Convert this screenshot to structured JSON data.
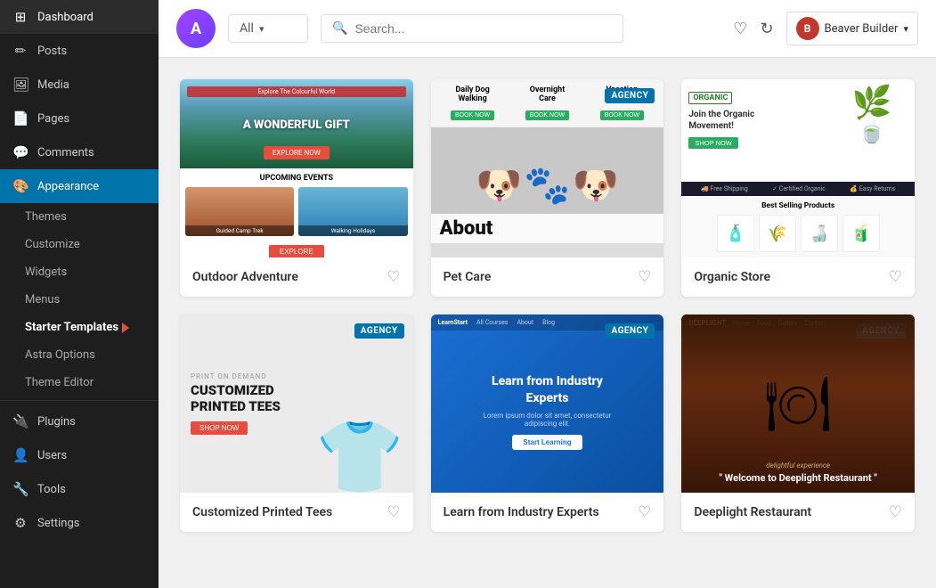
{
  "sidebar": {
    "logo_text": "A",
    "items": [
      {
        "id": "dashboard",
        "label": "Dashboard",
        "icon": "⊞"
      },
      {
        "id": "posts",
        "label": "Posts",
        "icon": "📝"
      },
      {
        "id": "media",
        "label": "Media",
        "icon": "🖼"
      },
      {
        "id": "pages",
        "label": "Pages",
        "icon": "📄"
      },
      {
        "id": "comments",
        "label": "Comments",
        "icon": "💬"
      },
      {
        "id": "appearance",
        "label": "Appearance",
        "icon": "🎨",
        "active": true
      },
      {
        "id": "plugins",
        "label": "Plugins",
        "icon": "🔌"
      },
      {
        "id": "users",
        "label": "Users",
        "icon": "👤"
      },
      {
        "id": "tools",
        "label": "Tools",
        "icon": "🔧"
      },
      {
        "id": "settings",
        "label": "Settings",
        "icon": "⚙"
      }
    ],
    "sub_items": [
      {
        "id": "themes",
        "label": "Themes"
      },
      {
        "id": "customize",
        "label": "Customize"
      },
      {
        "id": "widgets",
        "label": "Widgets"
      },
      {
        "id": "menus",
        "label": "Menus"
      },
      {
        "id": "starter-templates",
        "label": "Starter Templates",
        "active": true,
        "arrow": true
      },
      {
        "id": "astra-options",
        "label": "Astra Options"
      },
      {
        "id": "theme-editor",
        "label": "Theme Editor"
      }
    ]
  },
  "header": {
    "logo_letter": "A",
    "filter_label": "All",
    "search_placeholder": "Search...",
    "user_name": "Beaver Builder",
    "user_avatar_letter": "B"
  },
  "templates": [
    {
      "id": "outdoor-adventure",
      "title": "Outdoor Adventure",
      "badge": null,
      "type": "outdoor"
    },
    {
      "id": "pet-care",
      "title": "Pet Care",
      "badge": "AGENCY",
      "type": "petcare"
    },
    {
      "id": "organic-store",
      "title": "Organic Store",
      "badge": null,
      "type": "organic"
    },
    {
      "id": "tshirt",
      "title": "Customized Printed Tees",
      "badge": "AGENCY",
      "type": "tshirt"
    },
    {
      "id": "education",
      "title": "Learn from Industry Experts",
      "badge": "AGENCY",
      "type": "education"
    },
    {
      "id": "restaurant",
      "title": "Deeplight Restaurant",
      "badge": "AGENCY",
      "type": "restaurant"
    }
  ],
  "icons": {
    "heart": "♡",
    "search": "🔍",
    "refresh": "↻",
    "chevron_down": "▾",
    "arrow_right": "➜"
  }
}
